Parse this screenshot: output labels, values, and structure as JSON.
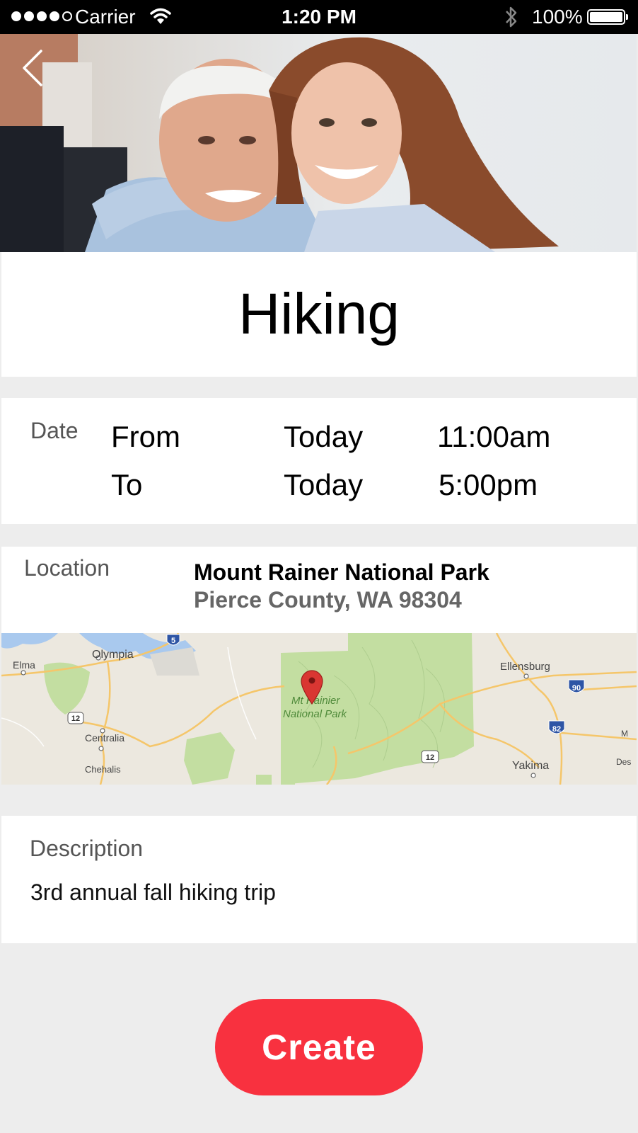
{
  "status_bar": {
    "carrier": "Carrier",
    "time": "1:20 PM",
    "battery": "100%"
  },
  "header": {
    "back_icon": "chevron-left-icon"
  },
  "event": {
    "title": "Hiking"
  },
  "date": {
    "label": "Date",
    "from_label": "From",
    "from_day": "Today",
    "from_time": "11:00am",
    "to_label": "To",
    "to_day": "Today",
    "to_time": "5:00pm"
  },
  "location": {
    "label": "Location",
    "name": "Mount Rainer National Park",
    "address": "Pierce County, WA 98304"
  },
  "map": {
    "places": [
      "Olympia",
      "Elma",
      "Centralia",
      "Chehalis",
      "Ellensburg",
      "Yakima"
    ],
    "park_label_line1": "Mt Rainier",
    "park_label_line2": "National Park",
    "shields": [
      "5",
      "12",
      "90",
      "82",
      "12"
    ],
    "edge_labels": [
      "M",
      "Des"
    ]
  },
  "description": {
    "label": "Description",
    "text": "3rd annual fall hiking trip"
  },
  "actions": {
    "create_label": "Create"
  },
  "colors": {
    "accent": "#f8313f",
    "background": "#ededed",
    "card": "#ffffff",
    "park_green": "#c3dea1"
  }
}
